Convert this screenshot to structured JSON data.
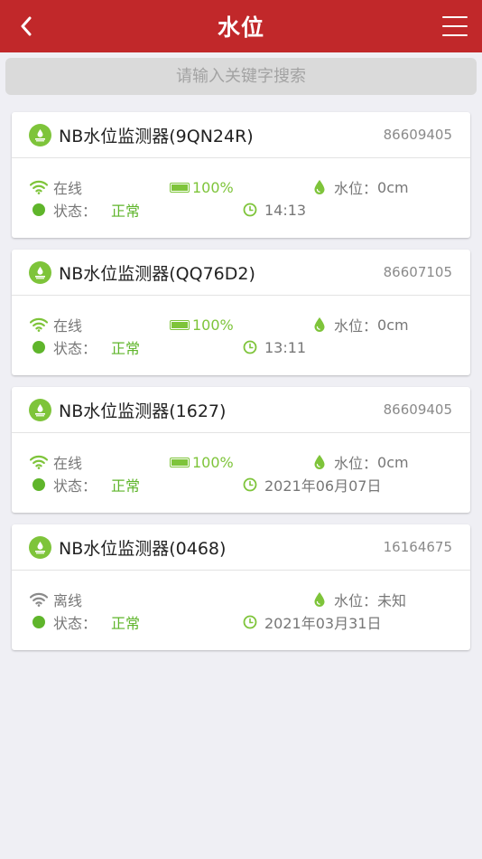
{
  "header": {
    "title": "水位"
  },
  "search": {
    "placeholder": "请输入关键字搜索"
  },
  "colors": {
    "header_bg": "#c1282a",
    "accent_green": "#5fb52b",
    "offline_gray": "#8a8a8a"
  },
  "labels": {
    "status": "状态：",
    "water_level": "水位："
  },
  "devices": [
    {
      "name": "NB水位监测器(9QN24R)",
      "id": "86609405",
      "connection": "在线",
      "online": true,
      "battery": "100%",
      "battery_level": 100,
      "water_level": "0cm",
      "status": "正常",
      "time": "14:13"
    },
    {
      "name": "NB水位监测器(QQ76D2)",
      "id": "86607105",
      "connection": "在线",
      "online": true,
      "battery": "100%",
      "battery_level": 100,
      "water_level": "0cm",
      "status": "正常",
      "time": "13:11"
    },
    {
      "name": "NB水位监测器(1627)",
      "id": "86609405",
      "connection": "在线",
      "online": true,
      "battery": "100%",
      "battery_level": 100,
      "water_level": "0cm",
      "status": "正常",
      "time": "2021年06月07日"
    },
    {
      "name": "NB水位监测器(0468)",
      "id": "16164675",
      "connection": "离线",
      "online": false,
      "battery": "",
      "battery_level": null,
      "water_level": "未知",
      "status": "正常",
      "time": "2021年03月31日"
    }
  ]
}
